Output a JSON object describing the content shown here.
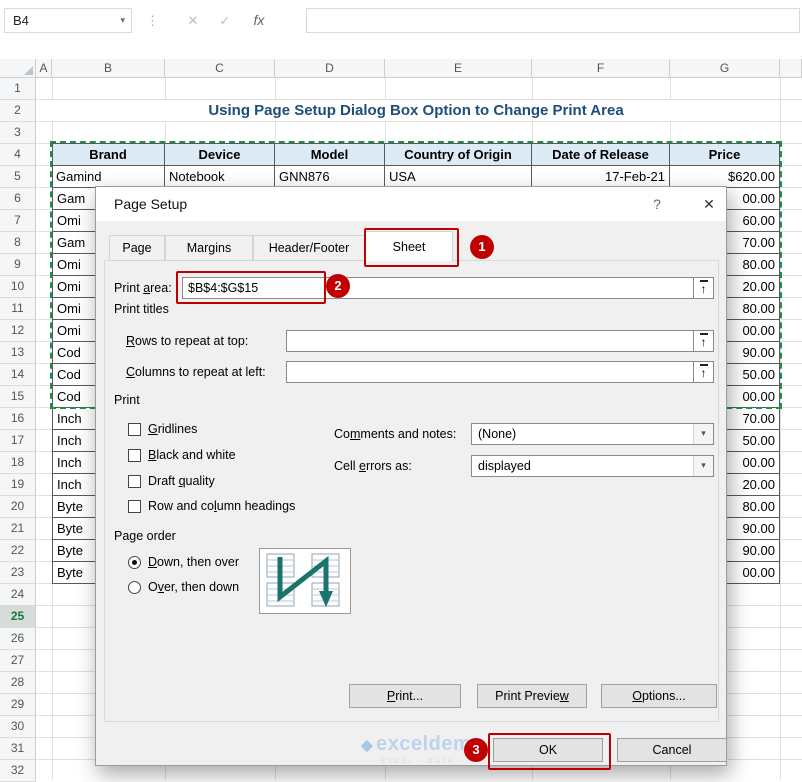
{
  "colors": {
    "title-blue": "#1F4E79",
    "header-fill": "#DDEBF7",
    "annotation-red": "#C00000",
    "marquee-green": "#1E8E4F",
    "watermark-blue": "#BCD4EA",
    "arrow-teal": "#1A746B"
  },
  "toolbar": {
    "name_box": "B4",
    "namebox_arrow": "▾",
    "dots_icon": "⋮",
    "cancel_icon": "✕",
    "enter_icon": "✓",
    "fx_icon": "fx",
    "formula_value": ""
  },
  "grid": {
    "columns": [
      "A",
      "B",
      "C",
      "D",
      "E",
      "F",
      "G"
    ],
    "rows": [
      "1",
      "2",
      "3",
      "4",
      "5",
      "6",
      "7",
      "8",
      "9",
      "10",
      "11",
      "12",
      "13",
      "14",
      "15",
      "16",
      "17",
      "18",
      "19",
      "20",
      "21",
      "22",
      "23",
      "24",
      "25",
      "26",
      "27",
      "28",
      "29",
      "30",
      "31",
      "32"
    ],
    "active_row": "25",
    "title": "Using Page Setup Dialog Box Option to Change Print Area",
    "table": {
      "headers": [
        "Brand",
        "Device",
        "Model",
        "Country of Origin",
        "Date of Release",
        "Price"
      ],
      "row5": [
        "Gamind",
        "Notebook",
        "GNN876",
        "USA",
        "17-Feb-21",
        "$620.00"
      ],
      "partial_rows": [
        {
          "row": "6",
          "brand": "Gam",
          "price": "00.00"
        },
        {
          "row": "7",
          "brand": "Omi",
          "price": "60.00"
        },
        {
          "row": "8",
          "brand": "Gam",
          "price": "70.00"
        },
        {
          "row": "9",
          "brand": "Omi",
          "price": "80.00"
        },
        {
          "row": "10",
          "brand": "Omi",
          "price": "20.00"
        },
        {
          "row": "11",
          "brand": "Omi",
          "price": "80.00"
        },
        {
          "row": "12",
          "brand": "Omi",
          "price": "00.00"
        },
        {
          "row": "13",
          "brand": "Cod",
          "price": "90.00"
        },
        {
          "row": "14",
          "brand": "Cod",
          "price": "50.00"
        },
        {
          "row": "15",
          "brand": "Cod",
          "price": "00.00"
        },
        {
          "row": "16",
          "brand": "Inch",
          "price": "70.00"
        },
        {
          "row": "17",
          "brand": "Inch",
          "price": "50.00"
        },
        {
          "row": "18",
          "brand": "Inch",
          "price": "00.00"
        },
        {
          "row": "19",
          "brand": "Inch",
          "price": "20.00"
        },
        {
          "row": "20",
          "brand": "Byte",
          "price": "80.00"
        },
        {
          "row": "21",
          "brand": "Byte",
          "price": "90.00"
        },
        {
          "row": "22",
          "brand": "Byte",
          "price": "90.00"
        },
        {
          "row": "23",
          "brand": "Byte",
          "price": "00.00"
        }
      ]
    }
  },
  "dialog": {
    "title": "Page Setup",
    "help": "?",
    "close": "✕",
    "tabs": [
      {
        "label": "Page",
        "active": false
      },
      {
        "label": "Margins",
        "active": false
      },
      {
        "label": "Header/Footer",
        "active": false
      },
      {
        "label": "Sheet",
        "active": true
      }
    ],
    "print_area": {
      "label": "Print area:",
      "u": 6,
      "value": "$B$4:$G$15"
    },
    "print_titles_label": "Print titles",
    "rows_repeat": {
      "label": "Rows to repeat at top:",
      "u": 0,
      "value": ""
    },
    "cols_repeat": {
      "label": "Columns to repeat at left:",
      "u": 0,
      "value": ""
    },
    "print_section_label": "Print",
    "checkboxes": [
      {
        "label": "Gridlines",
        "u": 0,
        "checked": false
      },
      {
        "label": "Black and white",
        "u": 0,
        "checked": false
      },
      {
        "label": "Draft quality",
        "u": 6,
        "checked": false
      },
      {
        "label": "Row and column headings",
        "u": 10,
        "checked": false
      }
    ],
    "comments": {
      "label": "Comments and notes:",
      "u": 2,
      "value": "(None)"
    },
    "cell_errors": {
      "label": "Cell errors as:",
      "u": 5,
      "value": "displayed"
    },
    "page_order_label": "Page order",
    "radios": [
      {
        "label": "Down, then over",
        "u": 0,
        "selected": true
      },
      {
        "label": "Over, then down",
        "u": 1,
        "selected": false
      }
    ],
    "buttons": [
      {
        "label": "Print...",
        "u": 0,
        "name": "print-button"
      },
      {
        "label": "Print Preview",
        "u": 12,
        "name": "print-preview-button"
      },
      {
        "label": "Options...",
        "u": 0,
        "name": "options-button"
      }
    ],
    "ok_label": "OK",
    "cancel_label": "Cancel",
    "collapse_icon": "↑",
    "dropdown_icon": "▾"
  },
  "annotations": {
    "step1": "1",
    "step2": "2",
    "step3": "3"
  },
  "watermark": {
    "logo": "◆",
    "brand": "exceldemy",
    "tagline": "EXCEL · DATA ·"
  }
}
